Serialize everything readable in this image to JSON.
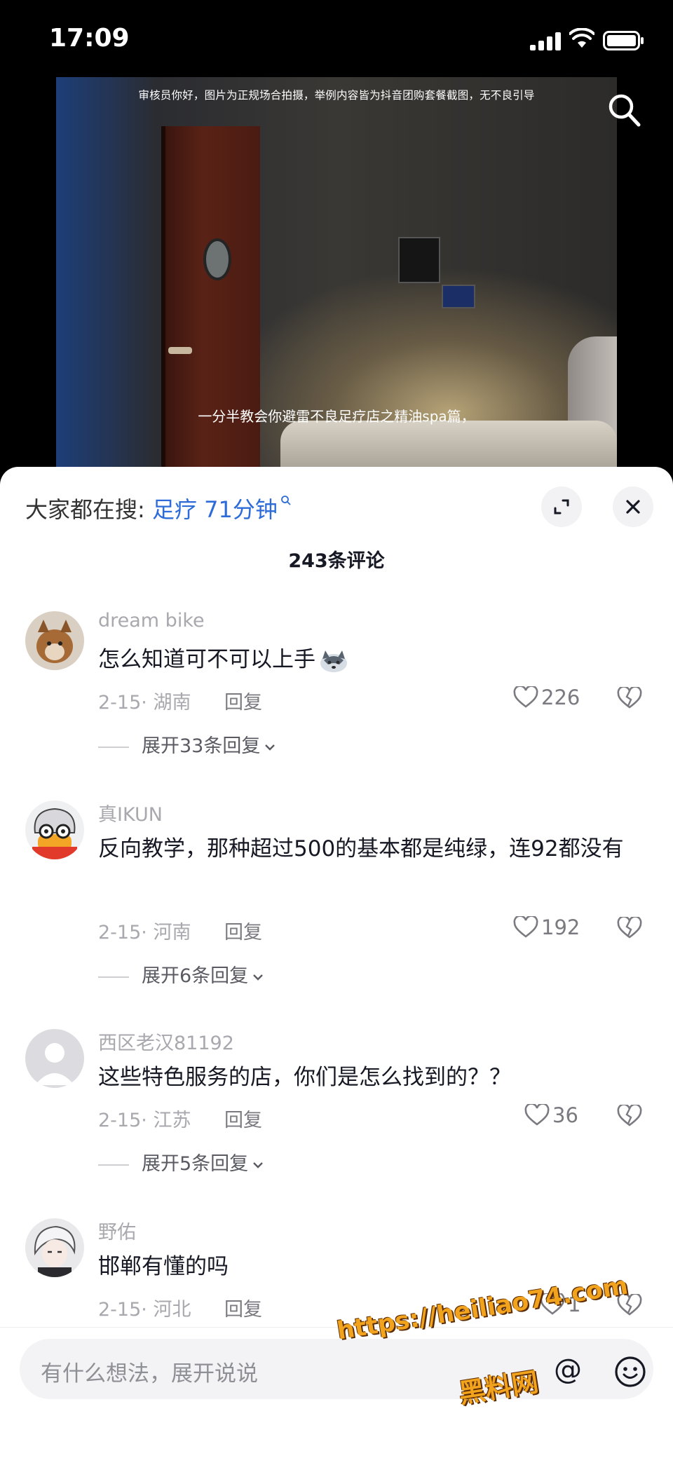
{
  "status_bar": {
    "time": "17:09"
  },
  "video": {
    "notice": "审核员你好，图片为正规场合拍摄，举例内容皆为抖音团购套餐截图，无不良引导",
    "subtitle": "一分半教会你避雷不良足疗店之精油spa篇，"
  },
  "comment_panel": {
    "trending_label": "大家都在搜: ",
    "trending_query": "足疗 71分钟",
    "comment_count": "243条评论",
    "comments": [
      {
        "username": "dream bike",
        "text": "怎么知道可不可以上手",
        "date_loc": "2-15· 湖南",
        "reply_label": "回复",
        "likes": "226",
        "expand": "展开33条回复"
      },
      {
        "username": "真IKUN",
        "text": "反向教学，那种超过500的基本都是纯绿，连92都没有",
        "date_loc": "2-15· 河南",
        "reply_label": "回复",
        "likes": "192",
        "expand": "展开6条回复"
      },
      {
        "username": "西区老汉81192",
        "text": "这些特色服务的店，你们是怎么找到的？？",
        "date_loc": "2-15· 江苏",
        "reply_label": "回复",
        "likes": "36",
        "expand": "展开5条回复"
      },
      {
        "username": "野佑",
        "text": "邯郸有懂的吗",
        "date_loc": "2-15· 河北",
        "reply_label": "回复",
        "likes": "1"
      }
    ]
  },
  "input_bar": {
    "placeholder": "有什么想法，展开说说"
  },
  "watermark": {
    "line1": "https://heiliao74.com",
    "line2": "黑料网"
  },
  "colors": {
    "link": "#2c6bd8",
    "watermark": "#f1a31d"
  }
}
